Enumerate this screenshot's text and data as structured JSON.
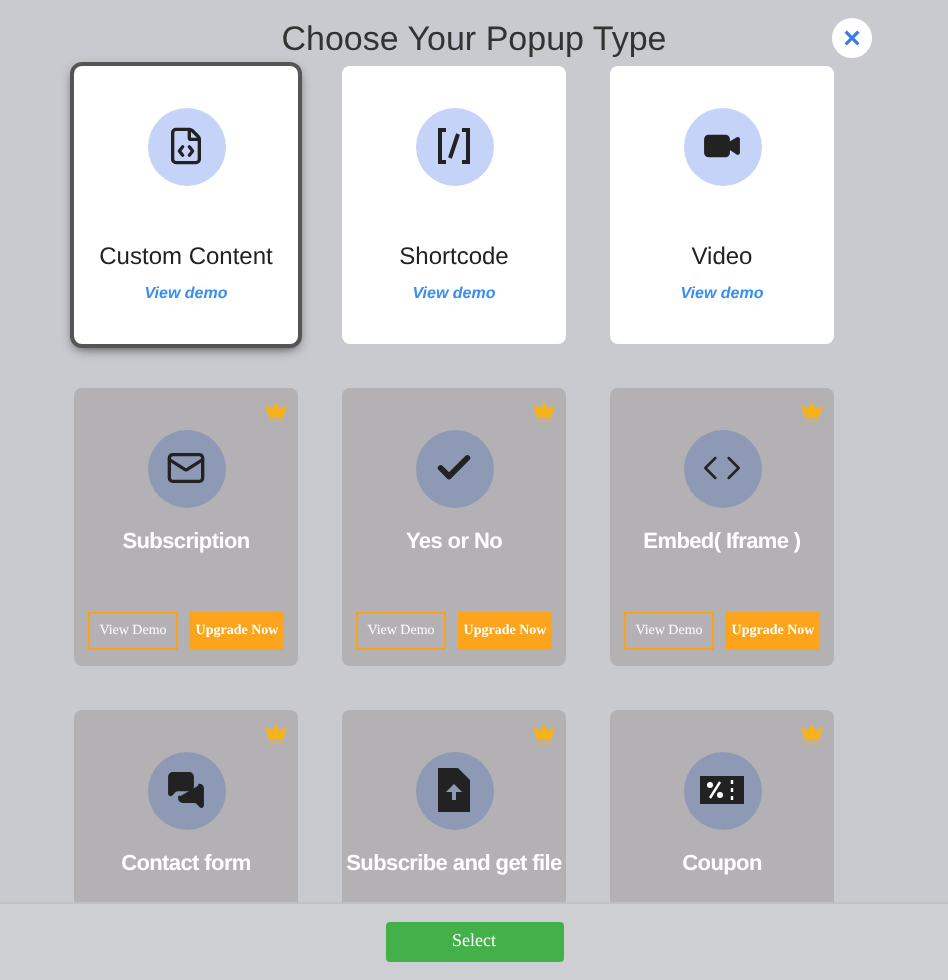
{
  "dialog": {
    "title": "Choose Your Popup Type",
    "close_label": "×"
  },
  "cards": [
    {
      "kind": "file-code",
      "title": "Custom Content",
      "locked": false,
      "selected": true,
      "demo_link": "View demo"
    },
    {
      "kind": "brackets",
      "title": "Shortcode",
      "locked": false,
      "selected": false,
      "demo_link": "View demo"
    },
    {
      "kind": "video",
      "title": "Video",
      "locked": false,
      "selected": false,
      "demo_link": "View demo"
    },
    {
      "kind": "mail",
      "title": "Subscription",
      "locked": true,
      "selected": false,
      "demo_button": "View Demo",
      "upgrade_button": "Upgrade Now"
    },
    {
      "kind": "check",
      "title": "Yes or No",
      "locked": true,
      "selected": false,
      "demo_button": "View Demo",
      "upgrade_button": "Upgrade Now"
    },
    {
      "kind": "code",
      "title": "Embed( Iframe )",
      "locked": true,
      "selected": false,
      "demo_button": "View Demo",
      "upgrade_button": "Upgrade Now"
    },
    {
      "kind": "chat",
      "title": "Contact form",
      "locked": true,
      "selected": false
    },
    {
      "kind": "file-upload",
      "title": "Subscribe and get file",
      "locked": true,
      "selected": false
    },
    {
      "kind": "coupon",
      "title": "Coupon",
      "locked": true,
      "selected": false
    }
  ],
  "footer": {
    "select_button": "Select"
  }
}
